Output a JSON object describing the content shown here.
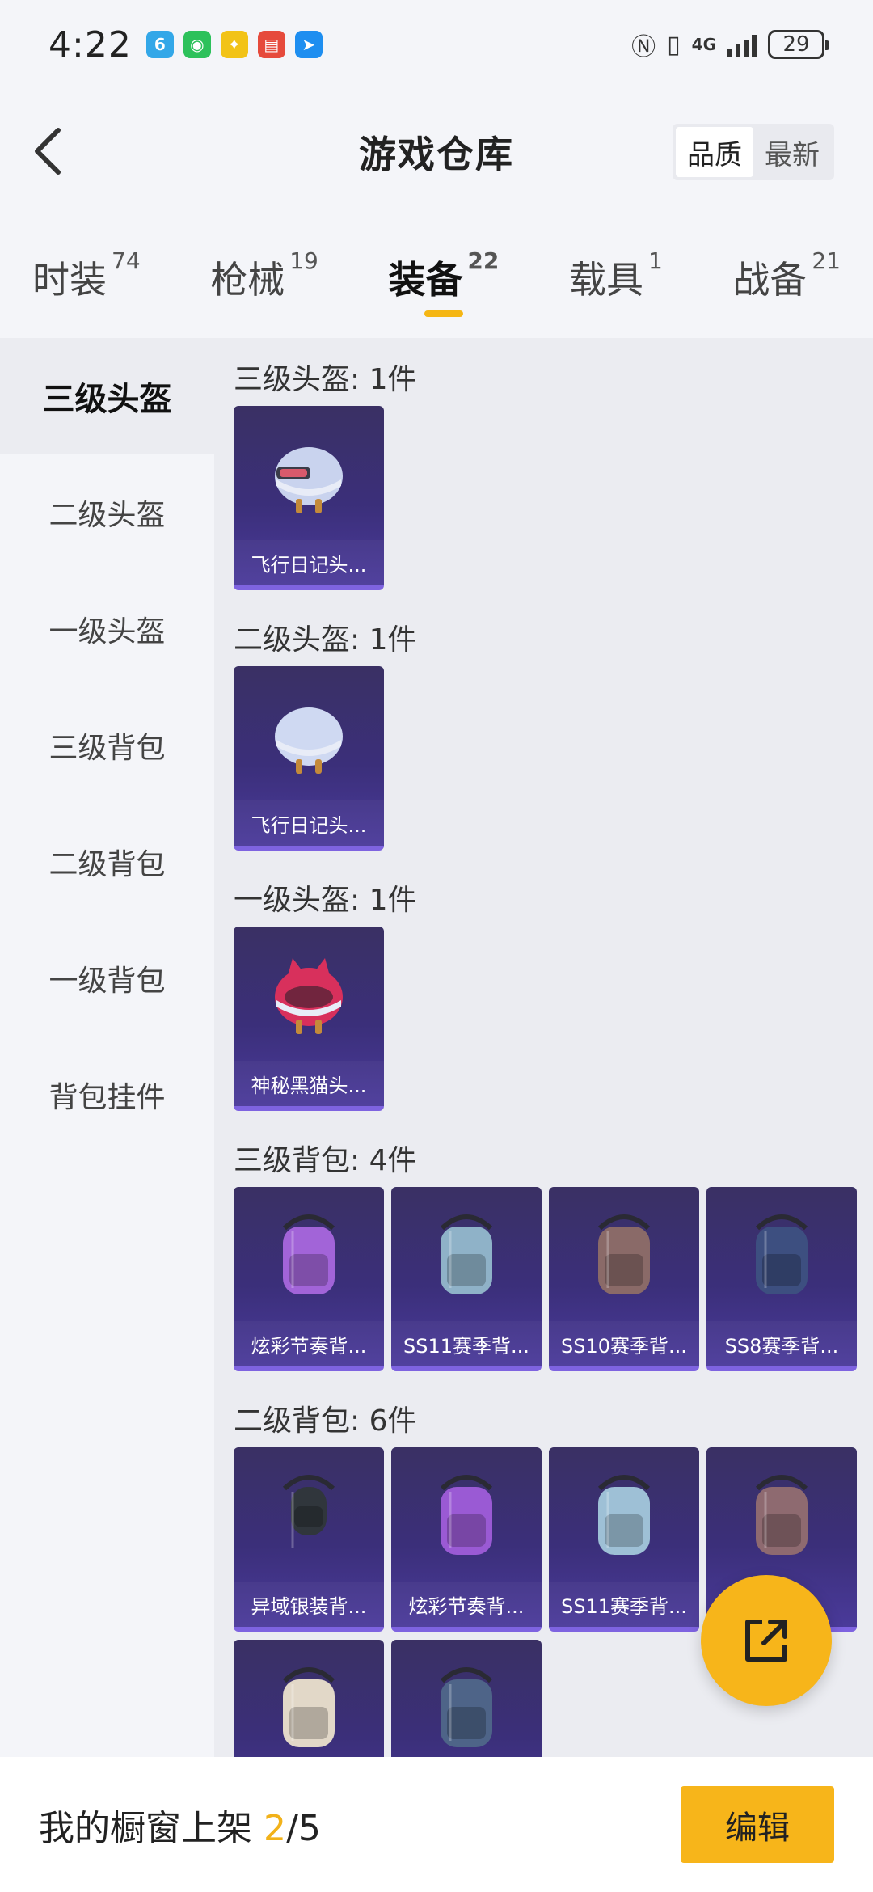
{
  "status_bar": {
    "time": "4:22",
    "network": "4G",
    "battery": "29",
    "notifications": [
      {
        "icon": "app-icon-blue",
        "glyph": "6",
        "color": "#33a7e8"
      },
      {
        "icon": "wechat-icon",
        "glyph": "◉",
        "color": "#2dc15b"
      },
      {
        "icon": "app-icon-yellow",
        "glyph": "✦",
        "color": "#f2c317"
      },
      {
        "icon": "app-icon-red",
        "glyph": "▤",
        "color": "#e64a3c"
      },
      {
        "icon": "app-icon-sky",
        "glyph": "➤",
        "color": "#1e8ef0"
      }
    ]
  },
  "header": {
    "title": "游戏仓库",
    "sort_options": [
      "品质",
      "最新"
    ],
    "sort_selected": "品质"
  },
  "tabs": [
    {
      "label": "时装",
      "count": "74"
    },
    {
      "label": "枪械",
      "count": "19"
    },
    {
      "label": "装备",
      "count": "22",
      "active": true
    },
    {
      "label": "载具",
      "count": "1"
    },
    {
      "label": "战备",
      "count": "21"
    }
  ],
  "sidebar": {
    "items": [
      "三级头盔",
      "二级头盔",
      "一级头盔",
      "三级背包",
      "二级背包",
      "一级背包",
      "背包挂件"
    ],
    "active": "三级头盔"
  },
  "sections": [
    {
      "title": "三级头盔: 1件",
      "items": [
        {
          "name": "飞行日记头...",
          "art": "helmet-lv3",
          "color": "#c9d3ee"
        }
      ]
    },
    {
      "title": "二级头盔: 1件",
      "items": [
        {
          "name": "飞行日记头...",
          "art": "helmet-lv2",
          "color": "#cfd9f2"
        }
      ]
    },
    {
      "title": "一级头盔: 1件",
      "items": [
        {
          "name": "神秘黑猫头...",
          "art": "helmet-lv1",
          "color": "#d8305c"
        }
      ]
    },
    {
      "title": "三级背包: 4件",
      "items": [
        {
          "name": "炫彩节奏背...",
          "art": "backpack",
          "color": "#a264d8"
        },
        {
          "name": "SS11赛季背...",
          "art": "backpack",
          "color": "#8fb2c8"
        },
        {
          "name": "SS10赛季背...",
          "art": "backpack",
          "color": "#8a6a68"
        },
        {
          "name": "SS8赛季背...",
          "art": "backpack",
          "color": "#3d4f80"
        }
      ]
    },
    {
      "title": "二级背包: 6件",
      "items": [
        {
          "name": "异域银装背...",
          "art": "backpack-small",
          "color": "#30363c"
        },
        {
          "name": "炫彩节奏背...",
          "art": "backpack",
          "color": "#9a5ad4"
        },
        {
          "name": "SS11赛季背...",
          "art": "backpack",
          "color": "#9ec0d6"
        },
        {
          "name": "",
          "art": "backpack",
          "color": "#8e6a70"
        },
        {
          "name": "",
          "art": "backpack",
          "color": "#e2d8c8"
        },
        {
          "name": "",
          "art": "backpack",
          "color": "#4e6488"
        }
      ]
    }
  ],
  "bottom": {
    "label": "我的橱窗上架",
    "current": "2",
    "total": "/5",
    "edit_label": "编辑"
  }
}
